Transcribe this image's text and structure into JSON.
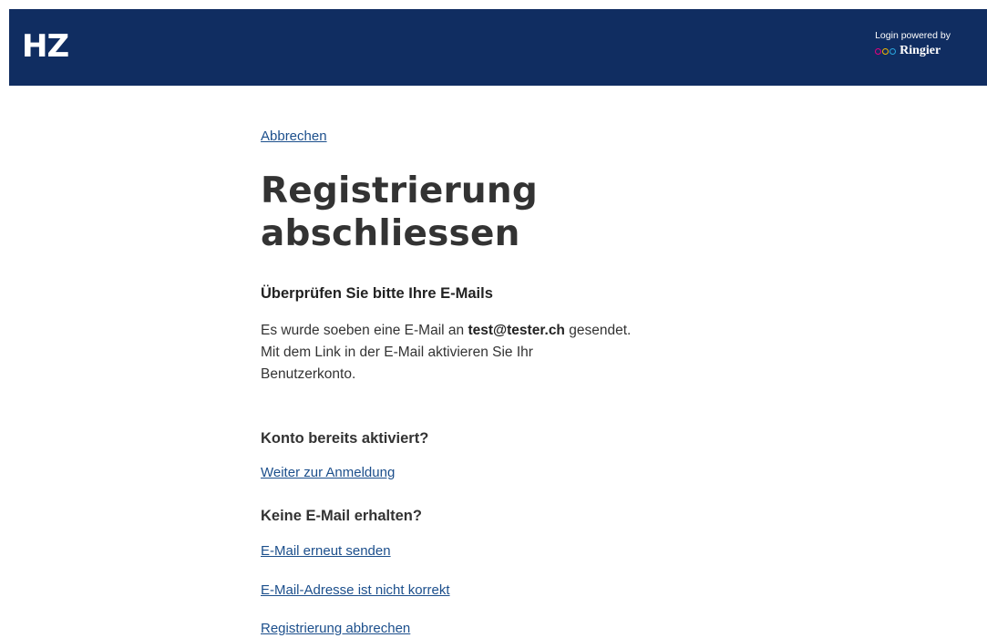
{
  "header": {
    "logo": "HZ",
    "powered_by": "Login powered by",
    "brand": "Ringier",
    "brand_circle_colors": [
      "#e6007e",
      "#f5b800",
      "#2aa6df"
    ],
    "background_color": "#102d61"
  },
  "main": {
    "cancel_link": "Abbrechen",
    "title_line1": "Registrierung",
    "title_line2": "abschliessen",
    "subheading": "Überprüfen Sie bitte Ihre E-Mails",
    "message_prefix": "Es wurde soeben eine E-Mail an",
    "email": "test@tester.ch",
    "message_suffix": "gesendet.",
    "message_line2": "Mit dem Link in der E-Mail aktivieren Sie Ihr",
    "message_line3": "Benutzerkonto.",
    "already_activated_heading": "Konto bereits aktiviert?",
    "continue_login_link": "Weiter zur Anmeldung",
    "no_email_heading": "Keine E-Mail erhalten?",
    "resend_email_link": "E-Mail erneut senden",
    "email_incorrect_link": "E-Mail-Adresse ist nicht korrekt",
    "cancel_registration_link": "Registrierung abbrechen"
  }
}
